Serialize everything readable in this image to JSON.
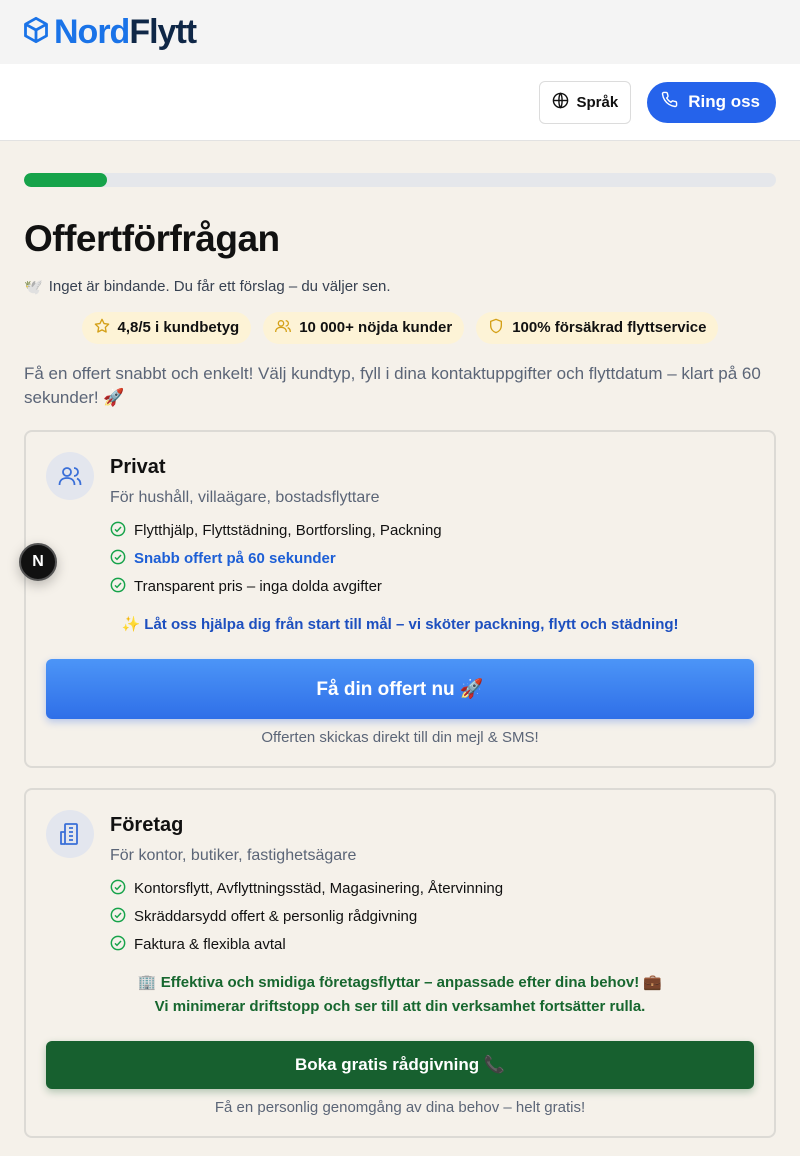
{
  "brand": {
    "part1": "Nord",
    "part2": "Flytt",
    "icon": "box-icon"
  },
  "header": {
    "language_label": "Språk",
    "call_label": "Ring oss"
  },
  "progress": {
    "value": 0.11
  },
  "page": {
    "title": "Offertförfrågan",
    "subtitle_emoji": "🕊️",
    "subtitle": "Inget är bindande. Du får ett förslag – du väljer sen.",
    "badges": [
      {
        "icon": "star-icon",
        "label": "4,8/5 i kundbetyg"
      },
      {
        "icon": "users-icon",
        "label": "10 000+ nöjda kunder"
      },
      {
        "icon": "shield-icon",
        "label": "100% försäkrad flyttservice"
      }
    ],
    "intro": "Få en offert snabbt och enkelt! Välj kundtyp, fyll i dina kontaktuppgifter och flyttdatum – klart på 60 sekunder! 🚀"
  },
  "cards": {
    "private": {
      "icon": "users-icon",
      "title": "Privat",
      "description": "För hushåll, villaägare, bostadsflyttare",
      "features": [
        "Flytthjälp, Flyttstädning, Bortforsling, Packning",
        "Snabb offert på 60 sekunder",
        "Transparent pris – inga dolda avgifter"
      ],
      "tagline": "✨ Låt oss hjälpa dig från start till mål – vi sköter packning, flytt och städning!",
      "cta": "Få din offert nu 🚀",
      "note": "Offerten skickas direkt till din mejl & SMS!"
    },
    "business": {
      "icon": "building-icon",
      "title": "Företag",
      "description": "För kontor, butiker, fastighetsägare",
      "features": [
        "Kontorsflytt, Avflyttningsstäd, Magasinering, Återvinning",
        "Skräddarsydd offert & personlig rådgivning",
        "Faktura & flexibla avtal"
      ],
      "tagline_line1": "🏢 Effektiva och smidiga företagsflyttar – anpassade efter dina behov! 💼",
      "tagline_line2": "Vi minimerar driftstopp och ser till att din verksamhet fortsätter rulla.",
      "cta": "Boka gratis rådgivning 📞",
      "note": "Få en personlig genomgång av dina behov – helt gratis!"
    }
  },
  "dev_badge": {
    "label": "N"
  },
  "colors": {
    "accent": "#2563eb",
    "progress": "#16a34a",
    "business_green": "#17602f",
    "background": "#f5f1ea"
  }
}
